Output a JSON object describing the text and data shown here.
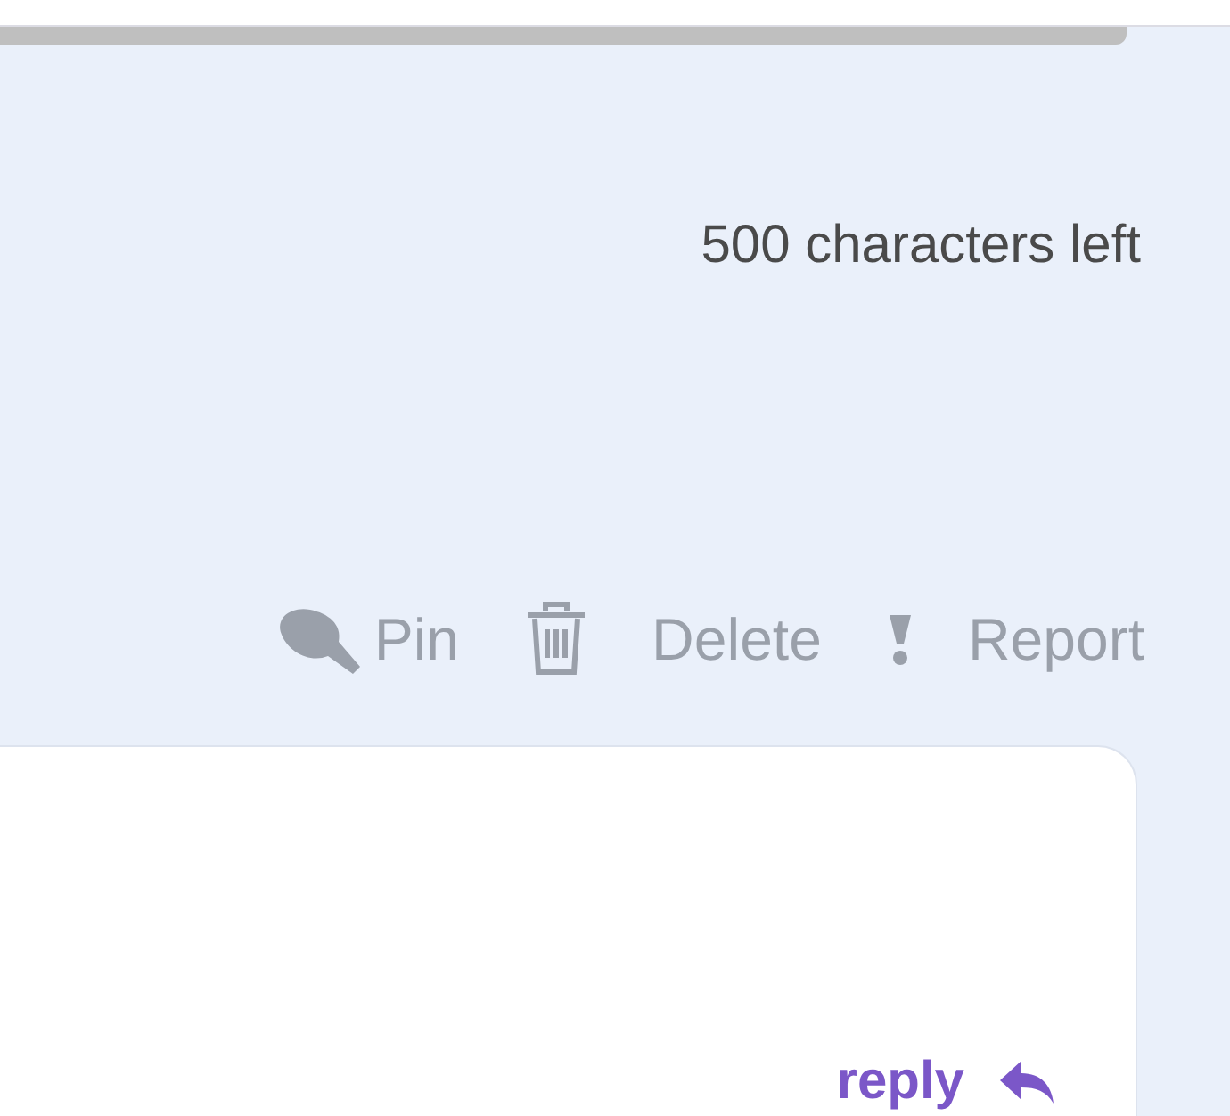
{
  "char_counter": "500 characters left",
  "actions": [
    {
      "kind": "pin",
      "label": "Pin"
    },
    {
      "kind": "delete",
      "label": "Delete"
    },
    {
      "kind": "report",
      "label": "Report"
    }
  ],
  "comment": {
    "reply": "reply"
  }
}
